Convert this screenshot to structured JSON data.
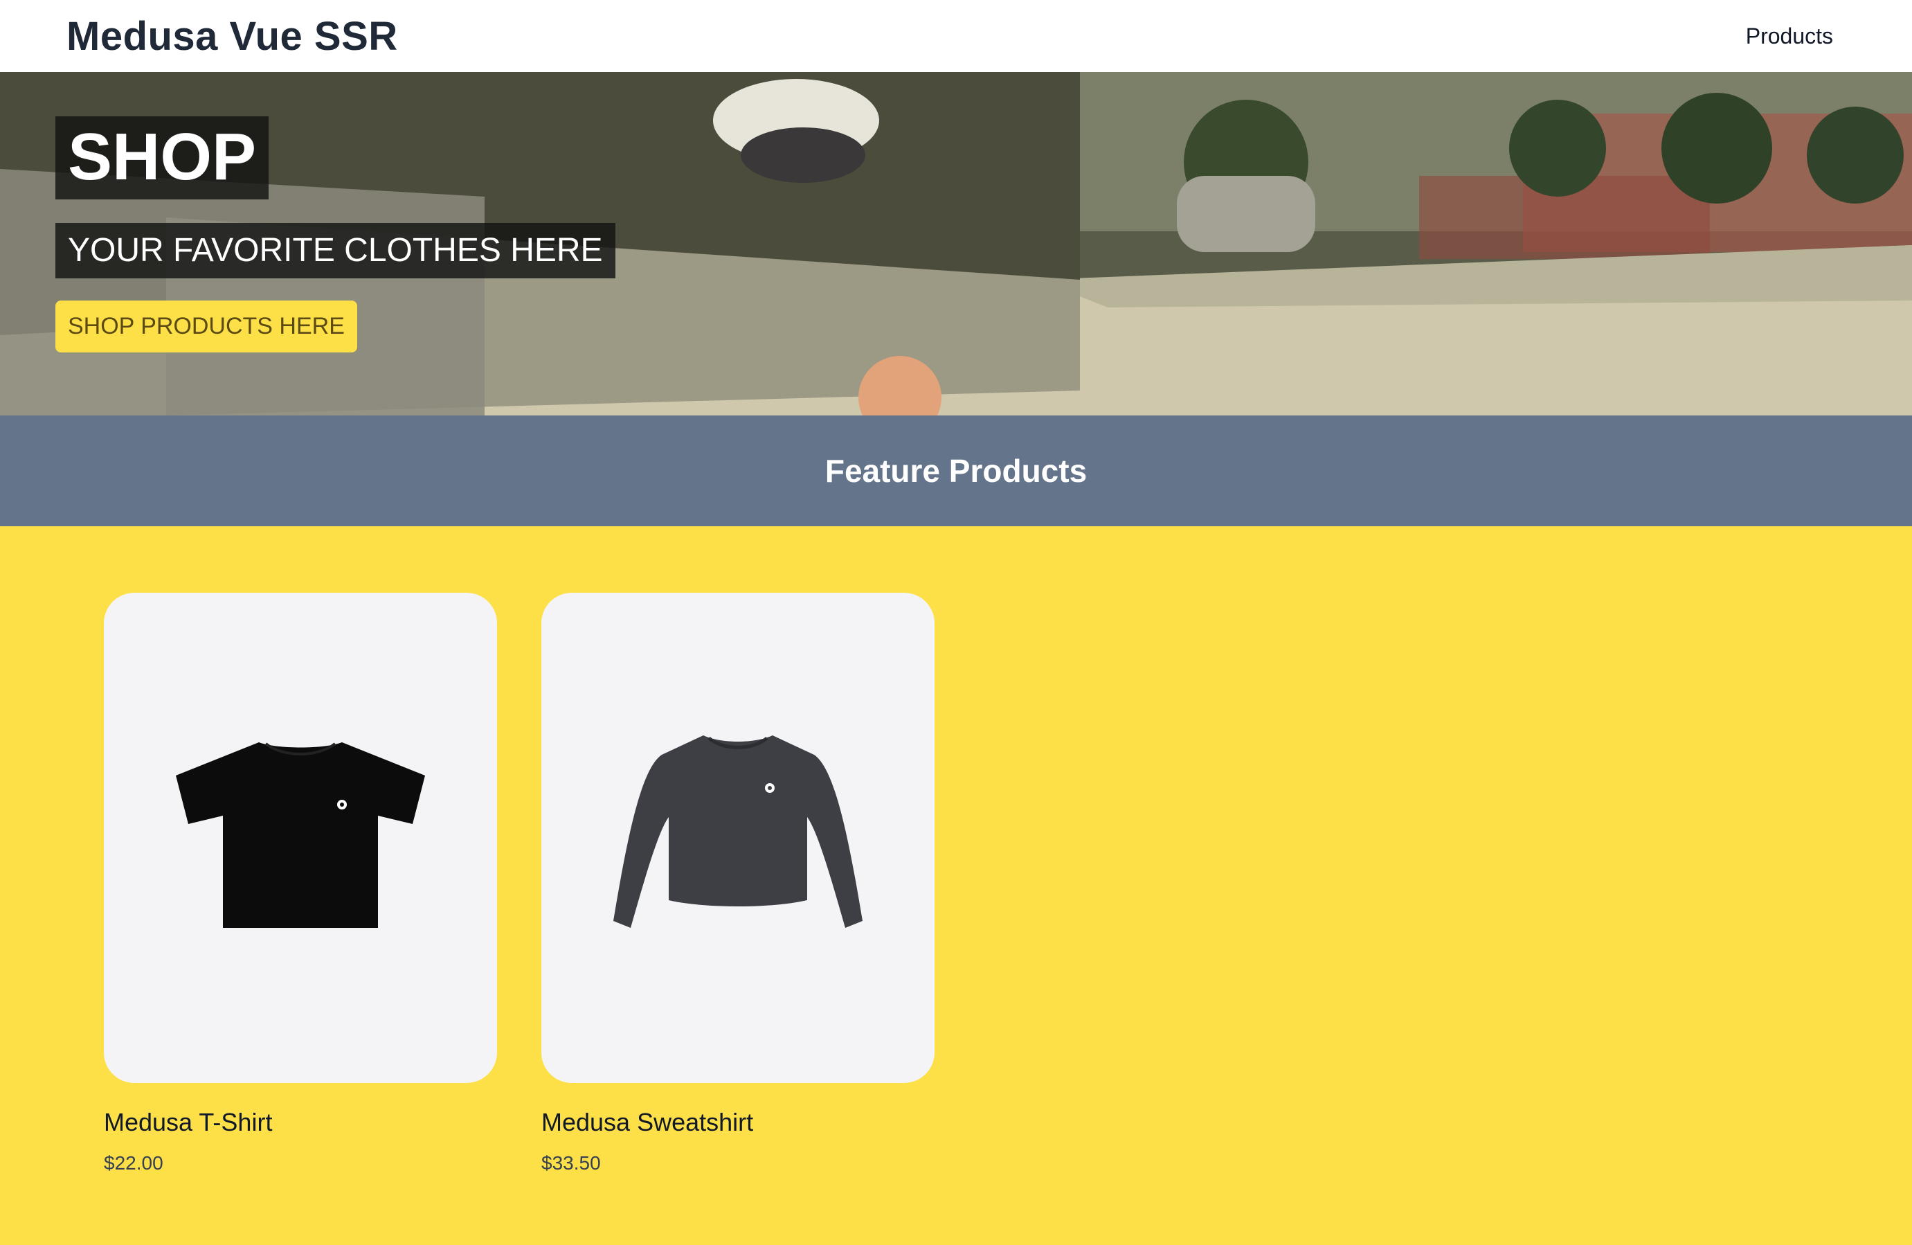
{
  "nav": {
    "brand": "Medusa Vue SSR",
    "links": [
      {
        "label": "Products"
      }
    ]
  },
  "hero": {
    "title": "SHOP",
    "subtitle": "YOUR FAVORITE CLOTHES HERE",
    "cta_label": "SHOP PRODUCTS HERE"
  },
  "featured": {
    "heading": "Feature Products",
    "products": [
      {
        "name": "Medusa T-Shirt",
        "price": "$22.00",
        "image_icon": "tshirt-icon"
      },
      {
        "name": "Medusa Sweatshirt",
        "price": "$33.50",
        "image_icon": "sweatshirt-icon"
      }
    ]
  },
  "colors": {
    "accent_yellow": "#fde047",
    "banner_slate": "#64748b",
    "card_bg": "#f4f4f6",
    "brand_text": "#1f2937"
  }
}
